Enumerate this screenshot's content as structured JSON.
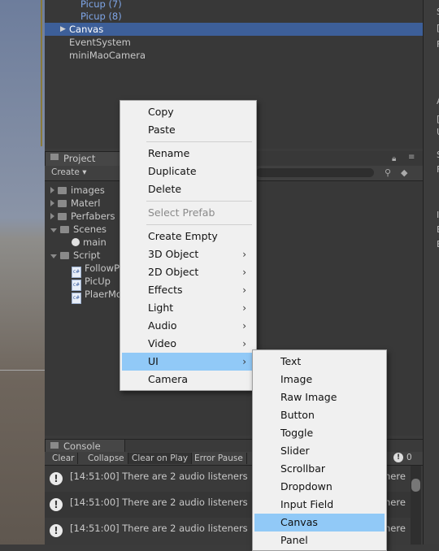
{
  "hierarchy": {
    "items": [
      {
        "label": "Picup (7)",
        "style": "blue"
      },
      {
        "label": "Picup (8)",
        "style": "blue"
      },
      {
        "label": "Canvas",
        "style": "selected"
      },
      {
        "label": "EventSystem",
        "style": "normal"
      },
      {
        "label": "miniMaoCamera",
        "style": "normal"
      }
    ]
  },
  "project": {
    "tab_label": "Project",
    "create_label": "Create ▾",
    "tree": [
      {
        "label": "images",
        "type": "folder"
      },
      {
        "label": "Materl",
        "type": "folder"
      },
      {
        "label": "Perfabers",
        "type": "folder"
      },
      {
        "label": "Scenes",
        "type": "folder"
      },
      {
        "label": "main",
        "type": "scene"
      },
      {
        "label": "Script",
        "type": "folder"
      },
      {
        "label": "FollowPl",
        "type": "script"
      },
      {
        "label": "PicUp",
        "type": "script"
      },
      {
        "label": "PlaerMo",
        "type": "script"
      }
    ]
  },
  "console": {
    "tab_label": "Console",
    "buttons": [
      "Clear",
      "Collapse",
      "Clear on Play",
      "Error Pause"
    ],
    "count": "0",
    "messages": [
      "[14:51:00] There are 2 audio listeners",
      "[14:51:00] There are 2 audio listeners",
      "[14:51:00] There are 2 audio listeners"
    ],
    "overflow_text": "here"
  },
  "context_menu": {
    "items": [
      {
        "label": "Copy"
      },
      {
        "label": "Paste"
      },
      {
        "label": "Rename"
      },
      {
        "label": "Duplicate"
      },
      {
        "label": "Delete"
      },
      {
        "label": "Select Prefab",
        "disabled": true
      },
      {
        "label": "Create Empty"
      },
      {
        "label": "3D Object",
        "submenu": true
      },
      {
        "label": "2D Object",
        "submenu": true
      },
      {
        "label": "Effects",
        "submenu": true
      },
      {
        "label": "Light",
        "submenu": true
      },
      {
        "label": "Audio",
        "submenu": true
      },
      {
        "label": "Video",
        "submenu": true
      },
      {
        "label": "UI",
        "submenu": true,
        "highlighted": true
      },
      {
        "label": "Camera"
      }
    ],
    "arrow": "›"
  },
  "ui_submenu": {
    "items": [
      "Text",
      "Image",
      "Raw Image",
      "Button",
      "Toggle",
      "Slider",
      "Scrollbar",
      "Dropdown",
      "Input Field",
      "Canvas",
      "Panel"
    ],
    "highlighted": "Canvas"
  },
  "inspector": {
    "chars": [
      "S",
      "[",
      "F",
      "A",
      "[",
      "U",
      "S",
      "F",
      "I",
      "E",
      "E"
    ]
  },
  "colors": {
    "selection": "#3d5f99",
    "menu_highlight": "#91c9f7",
    "prefab_text": "#7fa6e8"
  }
}
